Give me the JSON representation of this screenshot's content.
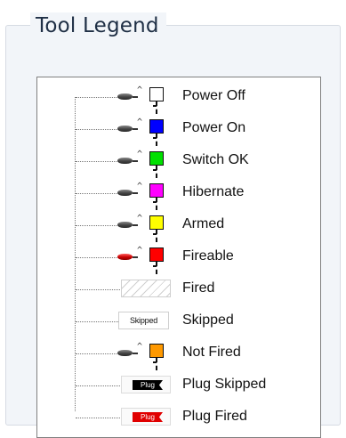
{
  "group": {
    "title": "Tool Legend"
  },
  "legend": {
    "items": [
      {
        "label": "Power Off",
        "kind": "switch",
        "color": "#ffffff",
        "plug_color": "gray"
      },
      {
        "label": "Power On",
        "kind": "switch",
        "color": "#0000ff",
        "plug_color": "gray"
      },
      {
        "label": "Switch OK",
        "kind": "switch",
        "color": "#00e000",
        "plug_color": "gray"
      },
      {
        "label": "Hibernate",
        "kind": "switch",
        "color": "#ff00ff",
        "plug_color": "gray"
      },
      {
        "label": "Armed",
        "kind": "switch",
        "color": "#ffff00",
        "plug_color": "gray"
      },
      {
        "label": "Fireable",
        "kind": "switch",
        "color": "#ff0000",
        "plug_color": "red"
      },
      {
        "label": "Fired",
        "kind": "fired"
      },
      {
        "label": "Skipped",
        "kind": "skipped",
        "tag_text": "Skipped"
      },
      {
        "label": "Not Fired",
        "kind": "switch",
        "color": "#ff9900",
        "plug_color": "gray"
      },
      {
        "label": "Plug Skipped",
        "kind": "plug-tag",
        "tag_text": "Plug",
        "tag_color": "#000000"
      },
      {
        "label": "Plug Fired",
        "kind": "plug-tag",
        "tag_text": "Plug",
        "tag_color": "#e00000"
      }
    ]
  }
}
